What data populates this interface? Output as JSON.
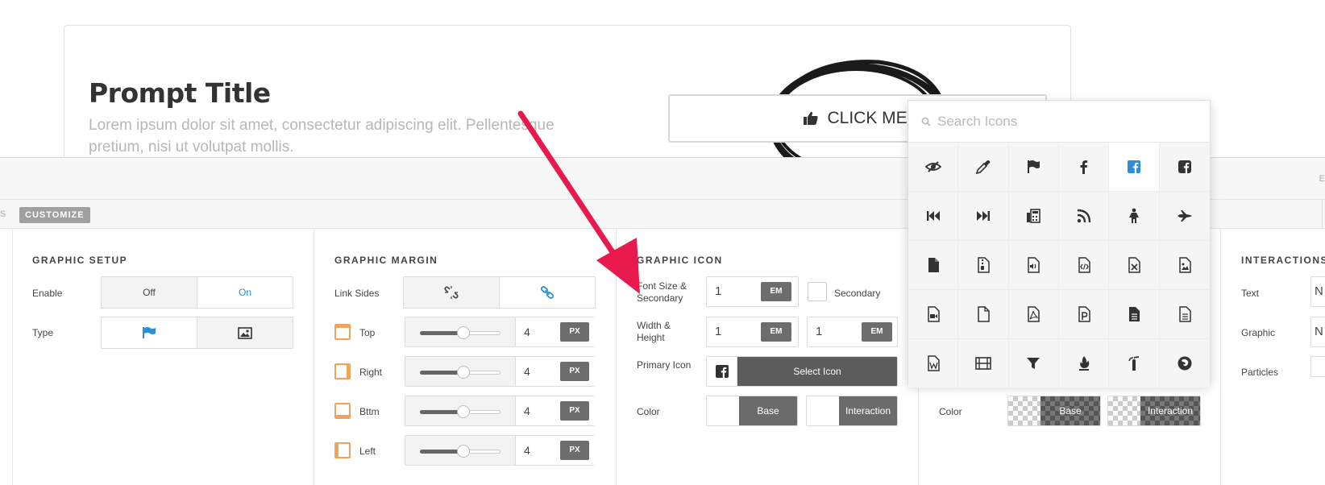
{
  "preview": {
    "title": "Prompt Title",
    "description": "Lorem ipsum dolor sit amet, consectetur adipiscing elit. Pellentesque pretium, nisi ut volutpat mollis.",
    "button_label": "CLICK ME!",
    "button_icon": "thumbs-up-icon"
  },
  "tabs": {
    "previous_tail": "S",
    "active": "CUSTOMIZE",
    "right_edge": "E"
  },
  "graphic_setup": {
    "title": "GRAPHIC SETUP",
    "enable_label": "Enable",
    "enable_off": "Off",
    "enable_on": "On",
    "type_label": "Type",
    "type_options": [
      "flag-icon",
      "image-icon"
    ]
  },
  "graphic_margin": {
    "title": "GRAPHIC MARGIN",
    "link_label": "Link Sides",
    "link_options": [
      "unlink-icon",
      "link-icon"
    ],
    "rows": [
      {
        "label": "Top",
        "value": "4",
        "unit": "PX",
        "slider": 0.5
      },
      {
        "label": "Right",
        "value": "4",
        "unit": "PX",
        "slider": 0.5
      },
      {
        "label": "Bttm",
        "value": "4",
        "unit": "PX",
        "slider": 0.5
      },
      {
        "label": "Left",
        "value": "4",
        "unit": "PX",
        "slider": 0.5
      }
    ]
  },
  "graphic_icon": {
    "title": "GRAPHIC ICON",
    "font_size_label": "Font Size & Secondary",
    "font_size_value": "1",
    "font_size_unit": "EM",
    "secondary_label": "Secondary",
    "wh_label": "Width & Height",
    "width_value": "1",
    "width_unit": "EM",
    "height_value": "1",
    "height_unit": "EM",
    "primary_label": "Primary Icon",
    "select_icon_label": "Select Icon",
    "primary_icon": "facebook-square-icon",
    "color_label": "Color",
    "base_label": "Base",
    "interaction_label": "Interaction"
  },
  "graphic_bg": {
    "color_label": "Color",
    "base_label": "Base",
    "interaction_label": "Interaction"
  },
  "interactions": {
    "title": "INTERACTIONS",
    "text_label": "Text",
    "graphic_label": "Graphic",
    "particles_label": "Particles",
    "text_value": "N",
    "graphic_value": "N"
  },
  "icon_picker": {
    "search_placeholder": "Search Icons",
    "icons": [
      "eye-slash-icon",
      "eyedropper-icon",
      "flag-icon",
      "facebook-icon",
      "facebook-square-icon",
      "facebook-official-icon",
      "fast-backward-icon",
      "fast-forward-icon",
      "fax-icon",
      "feed-icon",
      "female-icon",
      "fighter-jet-icon",
      "file-icon",
      "file-archive-icon",
      "file-audio-icon",
      "file-code-icon",
      "file-excel-icon",
      "file-image-icon",
      "file-movie-icon",
      "file-o-icon",
      "file-pdf-icon",
      "file-powerpoint-icon",
      "file-text-icon",
      "file-text-o-icon",
      "file-word-icon",
      "film-icon",
      "filter-icon",
      "fire-icon",
      "fire-extinguisher-icon",
      "firefox-icon"
    ],
    "selected_index": 4
  },
  "colors": {
    "accent_blue": "#2d8fd8",
    "margin_orange": "#f0a35e",
    "arrow_red": "#e8194d",
    "dark_button": "#5c5c5c"
  }
}
